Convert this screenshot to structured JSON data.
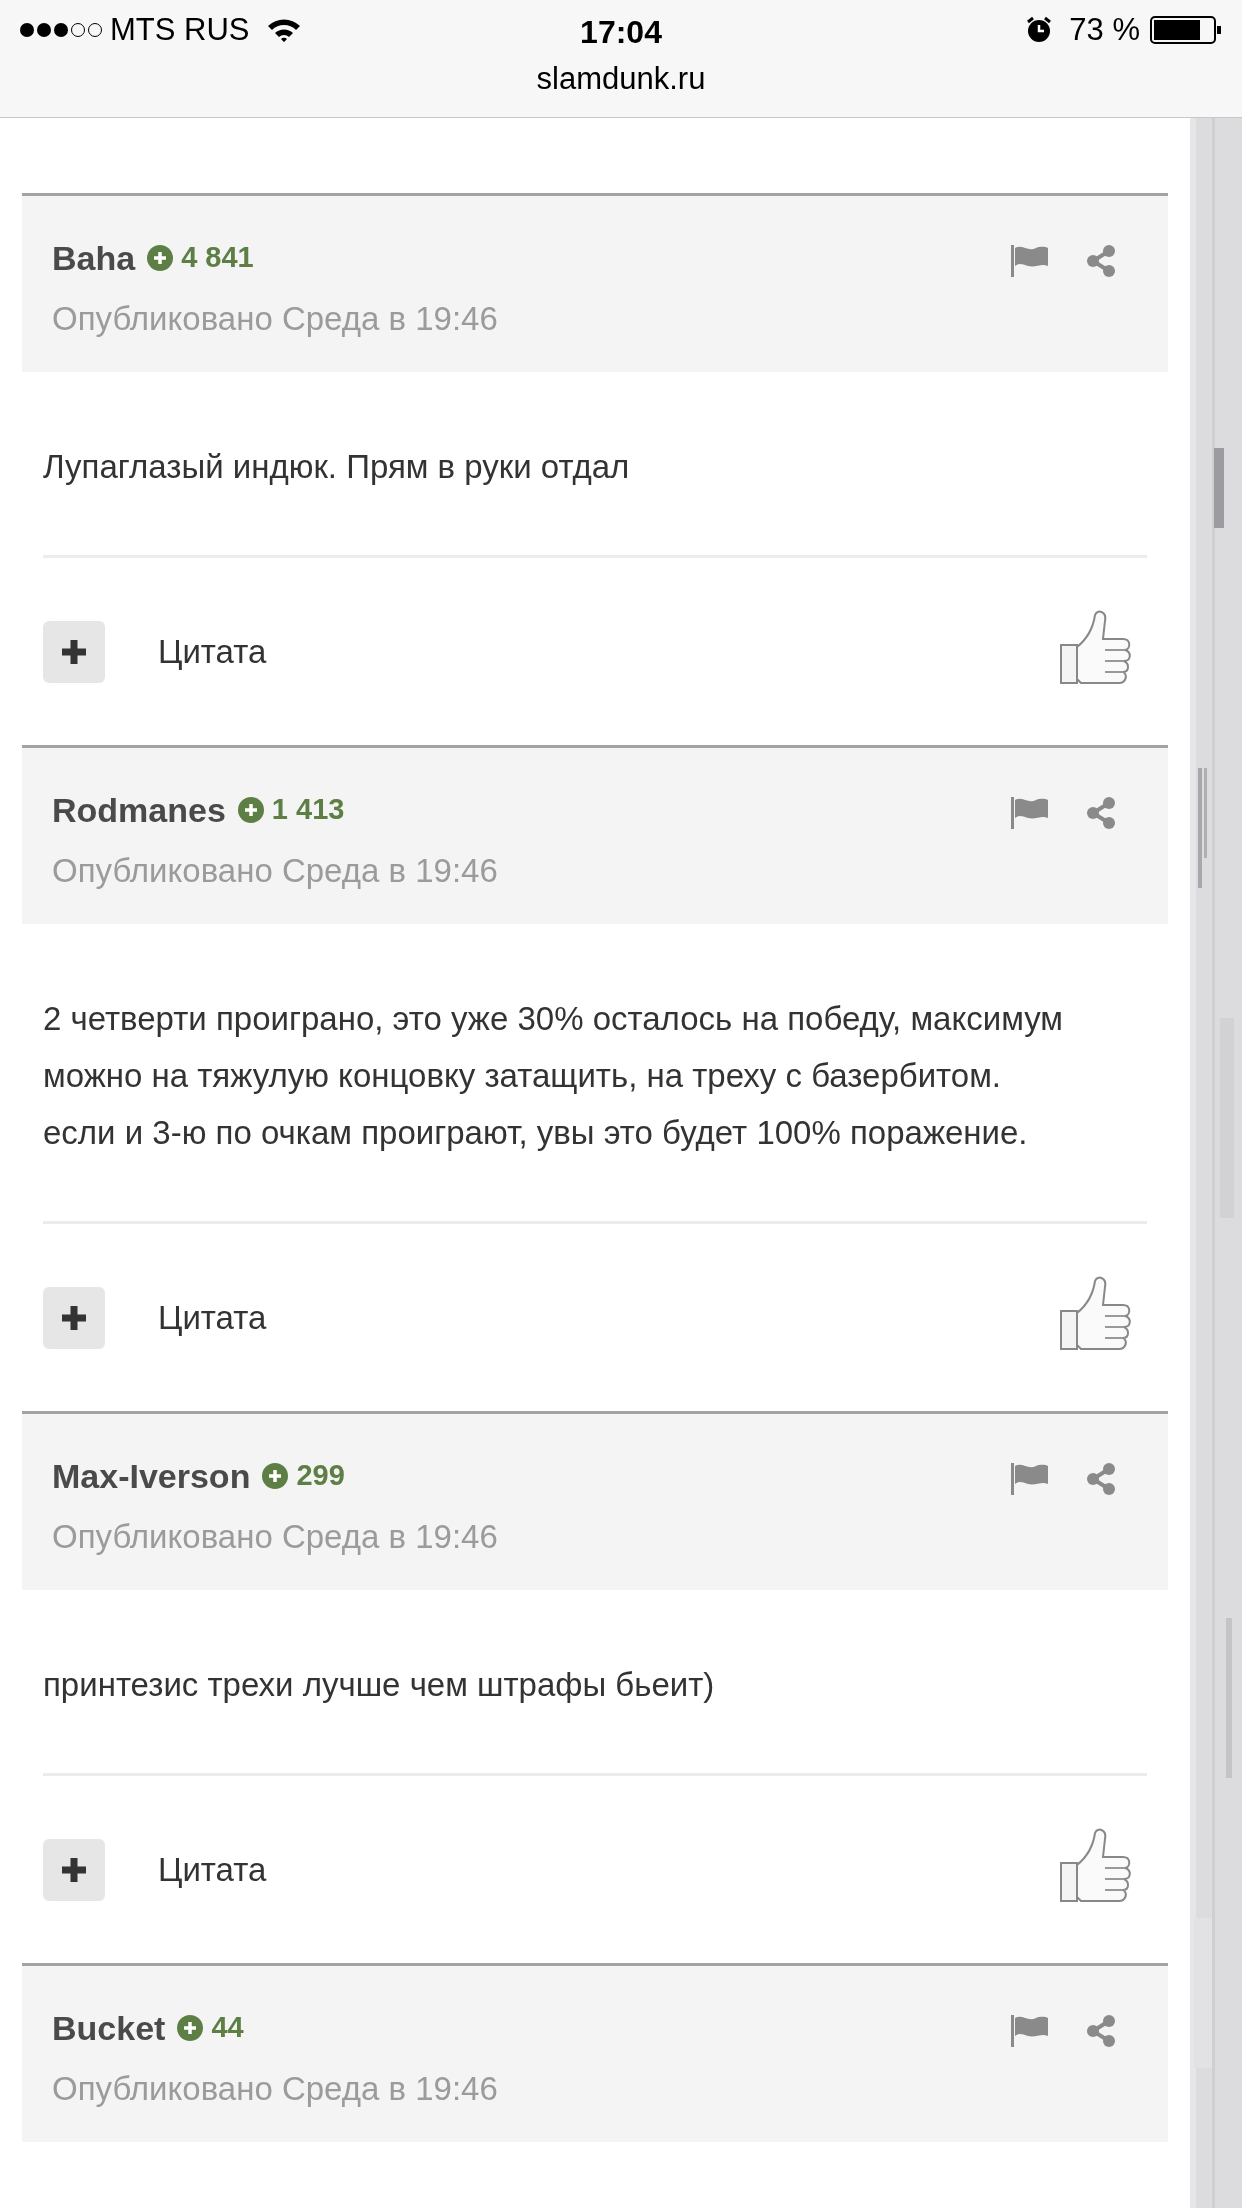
{
  "status_bar": {
    "carrier": "MTS RUS",
    "time": "17:04",
    "battery": "73 %"
  },
  "address_bar": {
    "url": "slamdunk.ru"
  },
  "posts": [
    {
      "author": "Baha",
      "reputation": "4 841",
      "date": "Опубликовано Среда в 19:46",
      "text": [
        "Лупаглазый индюк. Прям в руки отдал"
      ],
      "quote": "Цитата"
    },
    {
      "author": "Rodmanes",
      "reputation": "1 413",
      "date": "Опубликовано Среда в 19:46",
      "text": [
        "2 четверти проиграно, это уже 30% осталось на победу, максимум можно на тяжулую концовку затащить, на треху с базербитом. если и 3-ю по очкам проиграют, увы это будет 100% поражение."
      ],
      "quote": "Цитата"
    },
    {
      "author": "Max-Iverson",
      "reputation": "299",
      "date": "Опубликовано Среда в 19:46",
      "text": [
        "принтезис трехи лучше чем штрафы бьеит)"
      ],
      "quote": "Цитата"
    },
    {
      "author": "Bucket",
      "reputation": "44",
      "date": "Опубликовано Среда в 19:46"
    }
  ]
}
